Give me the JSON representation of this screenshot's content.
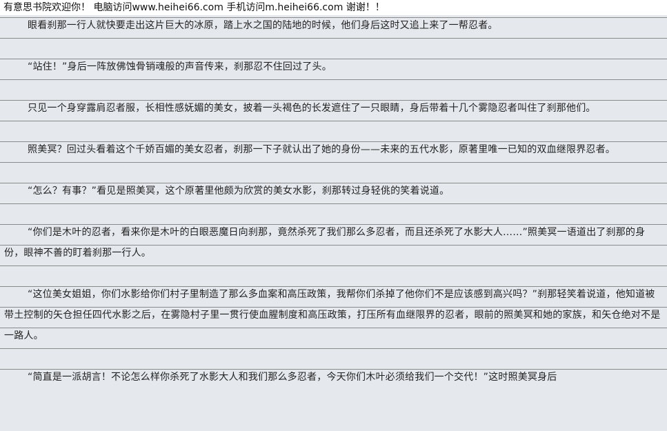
{
  "header": {
    "site_notice": "有意思书院欢迎你！  电脑访问www.heihei66.com   手机访问m.heihei66.com  谢谢！！"
  },
  "article": {
    "paragraphs": [
      "眼看刹那一行人就快要走出这片巨大的冰原，踏上水之国的陆地的时候，他们身后这时又追上来了一帮忍者。",
      "“站住！”身后一阵放佛蚀骨销魂般的声音传来，刹那忍不住回过了头。",
      "只见一个身穿露肩忍者服，长相性感妩媚的美女，披着一头褐色的长发遮住了一只眼睛，身后带着十几个雾隐忍者叫住了刹那他们。",
      "照美冥？回过头看着这个千娇百媚的美女忍者，刹那一下子就认出了她的身份——未来的五代水影，原著里唯一已知的双血继限界忍者。",
      "“怎么？有事？”看见是照美冥，这个原著里他颇为欣赏的美女水影，刹那转过身轻佻的笑着说道。",
      "“你们是木叶的忍者，看来你是木叶的白眼恶魔日向刹那，竟然杀死了我们那么多忍者，而且还杀死了水影大人……”照美冥一语道出了刹那的身份，眼神不善的盯着刹那一行人。",
      "“这位美女姐姐，你们水影给你们村子里制造了那么多血案和高压政策，我帮你们杀掉了他你们不是应该感到高兴吗？”刹那轻笑着说道，他知道被带土控制的矢仓担任四代水影之后，在雾隐村子里一贯行使血腥制度和高压政策，打压所有血继限界的忍者，眼前的照美冥和她的家族，和矢仓绝对不是一路人。",
      "“简直是一派胡言！不论怎么样你杀死了水影大人和我们那么多忍者，今天你们木叶必须给我们一个交代！”这时照美冥身后"
    ]
  }
}
